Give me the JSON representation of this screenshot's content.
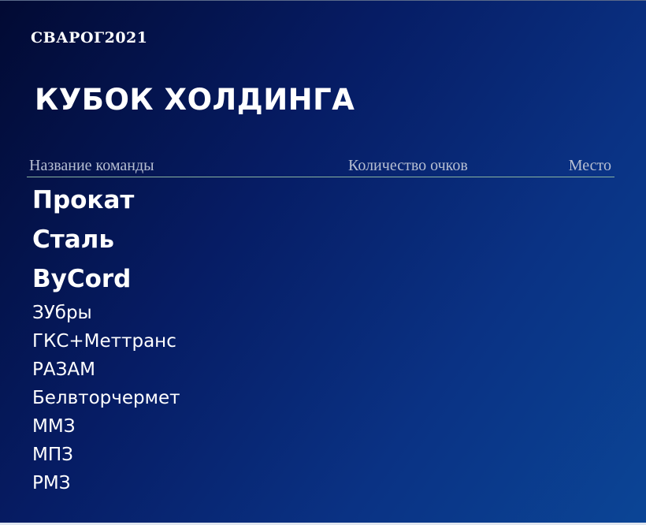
{
  "brand": "СВАРОГ2021",
  "title": "КУБОК ХОЛДИНГА",
  "table": {
    "headers": {
      "name": "Название команды",
      "points": "Количество очков",
      "place": "Место"
    },
    "teams": [
      {
        "name": "Прокат",
        "tier": "top"
      },
      {
        "name": "Сталь",
        "tier": "top"
      },
      {
        "name": "ByCord",
        "tier": "top"
      },
      {
        "name": "ЗУбры",
        "tier": "regular"
      },
      {
        "name": "ГКС+Меттранс",
        "tier": "regular"
      },
      {
        "name": "РАЗАМ",
        "tier": "regular"
      },
      {
        "name": "Белвторчермет",
        "tier": "regular"
      },
      {
        "name": "ММЗ",
        "tier": "regular"
      },
      {
        "name": "МПЗ",
        "tier": "regular"
      },
      {
        "name": "РМЗ",
        "tier": "regular"
      }
    ]
  },
  "colors": {
    "background_start": "#020a33",
    "background_end": "#0b4596",
    "header_text": "#b7bfd2",
    "header_rule": "#8ab4a0",
    "text": "#ffffff"
  }
}
